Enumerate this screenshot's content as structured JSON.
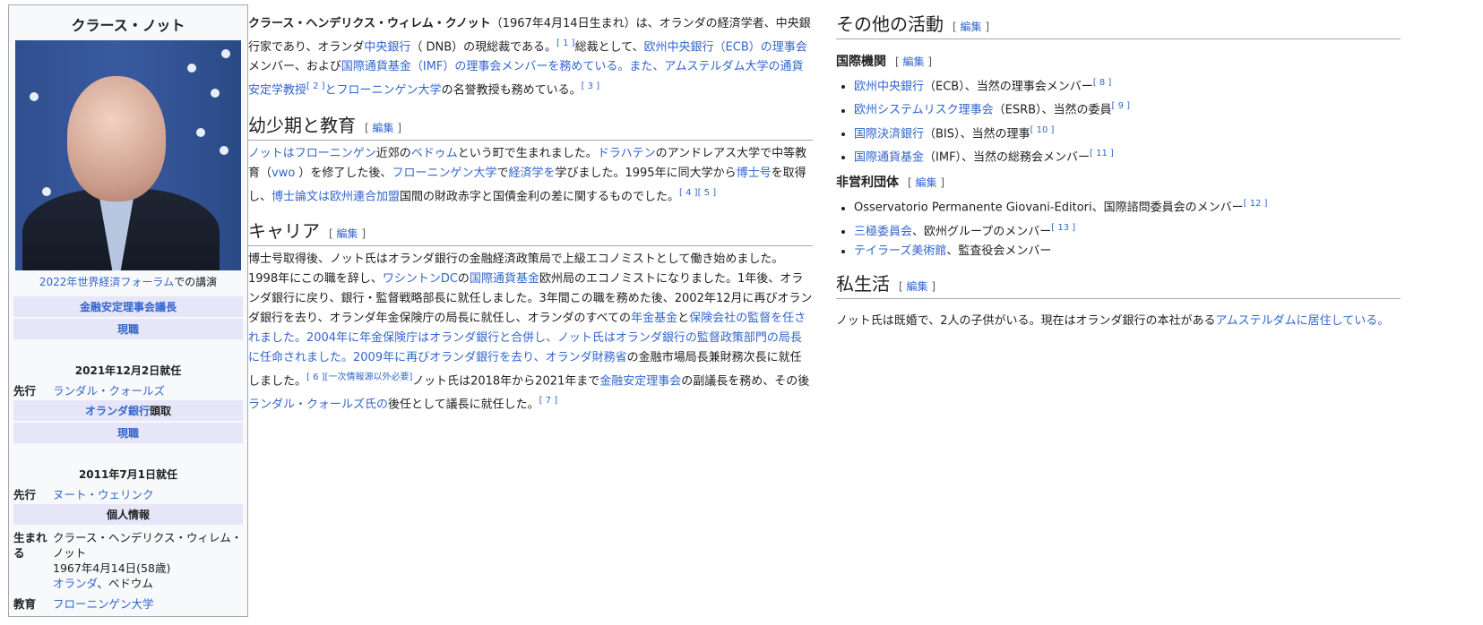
{
  "infobox": {
    "title": "クラース・ノット",
    "caption_link": "2022年世界経済フォーラム",
    "caption_rest": "での講演",
    "office1": "金融安定理事会議長",
    "status1": "現職",
    "assumed1": "2021年12月2日就任",
    "pred_label": "先行",
    "pred1": "ランダル・クォールズ",
    "office2_link": "オランダ銀行",
    "office2_rest": "頭取",
    "status2": "現職",
    "assumed2": "2011年7月1日就任",
    "pred2": "ヌート・ウェリンク",
    "personal": "個人情報",
    "born_label": "生まれる",
    "born_name": "クラース・ヘンデリクス・ウィレム・ノット",
    "born_date": "1967年4月14日(58歳)",
    "born_place_link": "オランダ",
    "born_place_rest": "、ベドウム",
    "edu_label": "教育",
    "edu": "フローニンゲン大学"
  },
  "intro": {
    "bold_name": "クラース・ヘンデリクス・ウィレム・クノット",
    "t1": "（1967年4月14日生まれ）は、オランダの経済学者、中央銀行家であり、オランダ",
    "l1": "中央銀行",
    "t2": "（ DNB）の現総裁である。",
    "r1": "[ 1 ]",
    "t3": "総裁として、",
    "l2": "欧州中央銀行（ECB）の理事会",
    "t4": "メンバー、および",
    "l3": "国際通貨基金（IMF）の理事会メンバーを務めている。また、アムステルダム大学の通貨安定学教授",
    "r2": "[ 2 ]",
    "l4": "とフローニンゲン大学",
    "t5": "の名誉教授も務めている。",
    "r3": "[ 3 ]"
  },
  "early": {
    "heading": "幼少期と教育",
    "edit": "編集",
    "l1": "ノットはフローニンゲン",
    "t1": "近郊の",
    "l2": "ベドゥム",
    "t2": "という町で生まれました。",
    "l3": "ドラハテン",
    "t3": "のアンドレアス大学で中等教育（",
    "l4": "vwo",
    "t4": " ）を修了した後、",
    "l5": "フローニンゲン大学",
    "t5": "で",
    "l6": "経済学を",
    "t6": "学びました。1995年に同大学から",
    "l7": "博士号",
    "t7": "を取得し、",
    "l8": "博士論文は欧州連合加盟",
    "t8": "国間の財政赤字と国債金利の差に関するものでした。",
    "r1": "[ 4 ]",
    "r2": "[ 5 ]"
  },
  "career": {
    "heading": "キャリア",
    "edit": "編集",
    "t1": "博士号取得後、ノット氏はオランダ銀行の金融経済政策局で上級エコノミストとして働き始めました。1998年にこの職を辞し、",
    "l1": "ワシントンDC",
    "t2": "の",
    "l2": "国際通貨基金",
    "t3": "欧州局のエコノミストになりました。1年後、オランダ銀行に戻り、銀行・監督戦略部長に就任しました。3年間この職を務めた後、2002年12月に再びオランダ銀行を去り、オランダ年金保険庁の局長に就任し、オランダのすべての",
    "l3": "年金基金",
    "t4": "と",
    "l4": "保険会社の監督を任されました。2004年に年金保険庁はオランダ銀行と合併し、ノット氏はオランダ銀行の監督政策部門の局長に任命されました。2009年に再びオランダ銀行を去り、オランダ財務省",
    "t5": "の金融市場局長兼財務次長に就任しました。",
    "r1": "[ 6 ]",
    "r2": "[一次情報源以外必要]",
    "t6": "ノット氏は2018年から2021年まで",
    "l5": "金融安定理事会",
    "t7": "の副議長を務め、その後",
    "l6": "ランダル・クォールズ氏の",
    "t8": "後任として議長に就任した。",
    "r3": "[ 7 ]"
  },
  "other": {
    "heading": "その他の活動",
    "edit": "編集",
    "intl_heading": "国際機関",
    "intl": [
      {
        "link": "欧州中央銀行",
        "rest": "（ECB）、当然の理事会メンバー",
        "ref": "[ 8 ]"
      },
      {
        "link": "欧州システムリスク理事会",
        "rest": "（ESRB）、当然の委員",
        "ref": "[ 9 ]"
      },
      {
        "link": "国際決済銀行",
        "rest": "（BIS）、当然の理事",
        "ref": "[ 10 ]"
      },
      {
        "link": "国際通貨基金",
        "rest": "（IMF）、当然の総務会メンバー",
        "ref": "[ 11 ]"
      }
    ],
    "np_heading": "非営利団体",
    "np": [
      {
        "link": "",
        "rest": "Osservatorio Permanente Giovani-Editori、国際諮問委員会のメンバー",
        "ref": "[ 12 ]"
      },
      {
        "link": "三極委員会",
        "rest": "、欧州グループのメンバー",
        "ref": "[ 13 ]"
      },
      {
        "link": "テイラーズ美術館",
        "rest": "、監査役会メンバー",
        "ref": ""
      }
    ]
  },
  "personal_life": {
    "heading": "私生活",
    "edit": "編集",
    "t1": "ノット氏は既婚で、2人の子供がいる。現在はオランダ銀行の本社がある",
    "l1": "アムステルダムに居住している。"
  }
}
